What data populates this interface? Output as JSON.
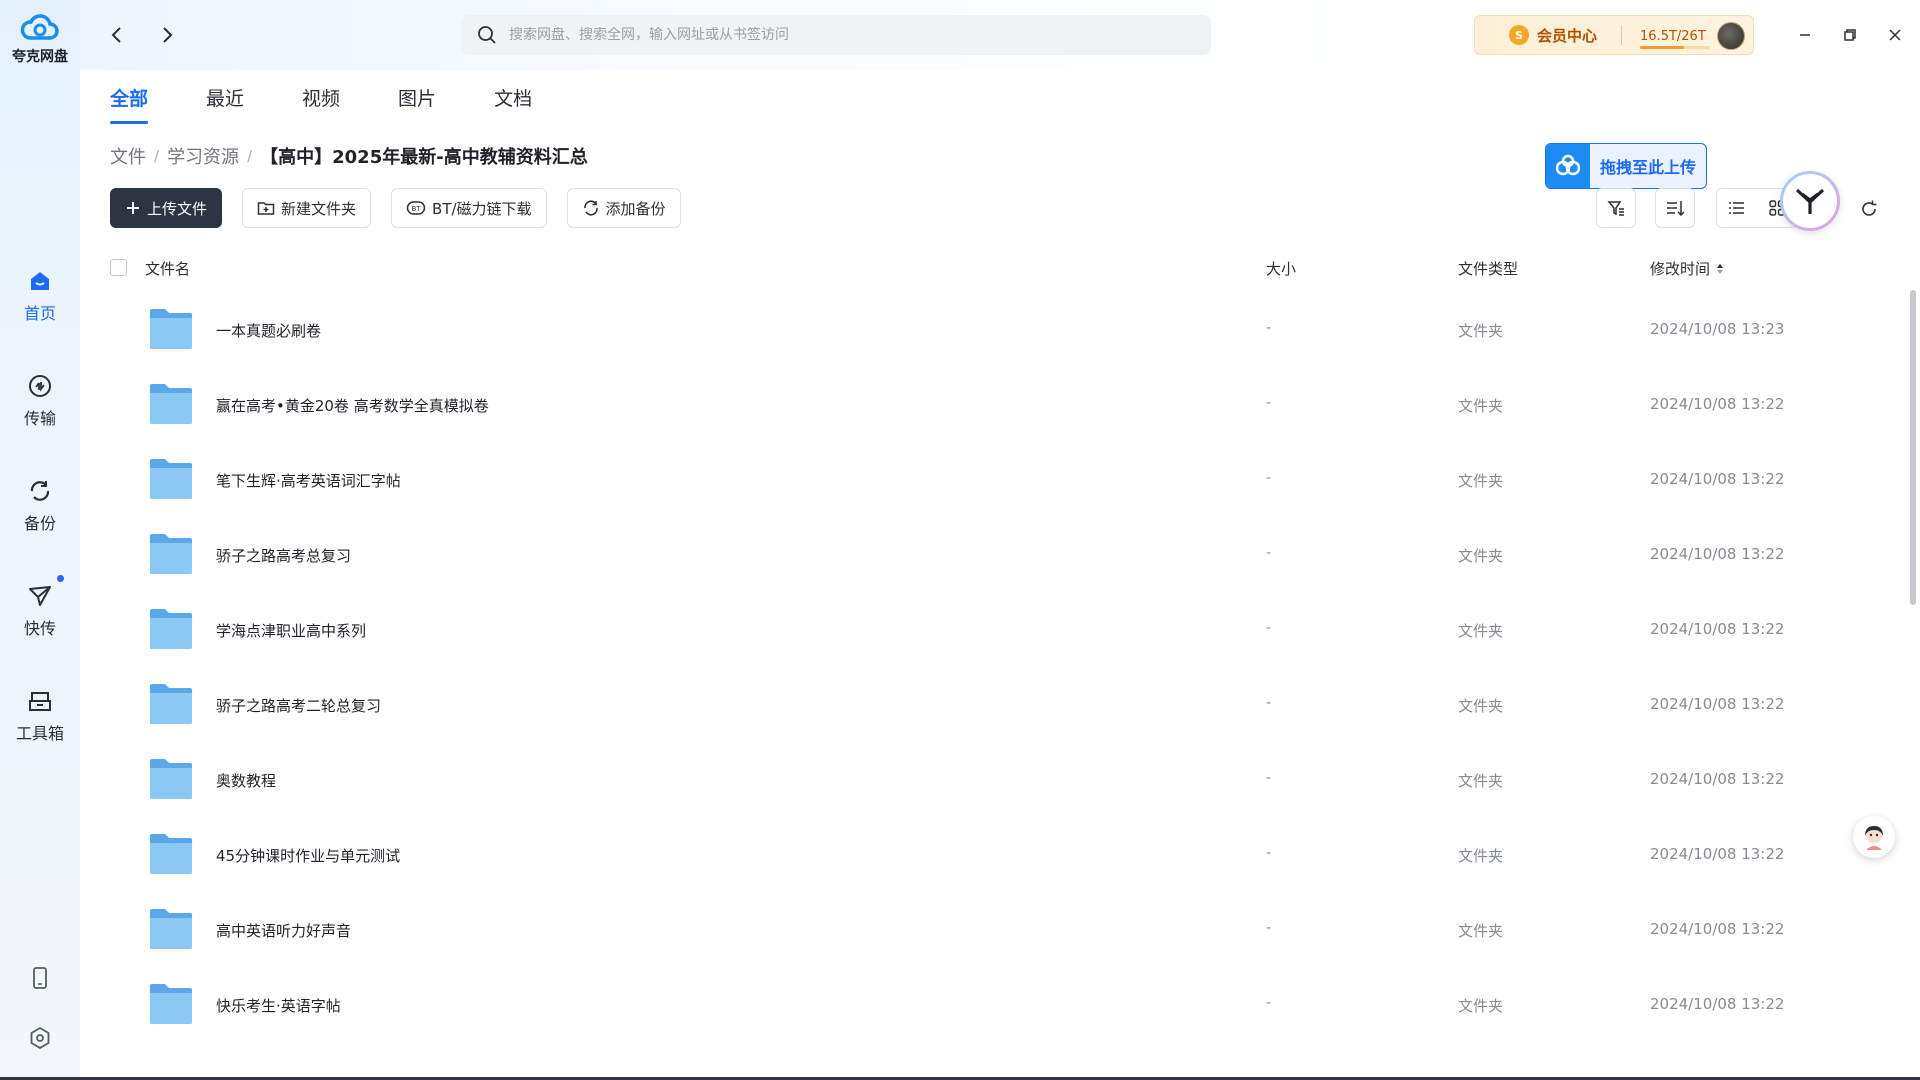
{
  "app": {
    "name": "夸克网盘"
  },
  "sidebar": {
    "items": [
      {
        "label": "首页",
        "icon": "home-icon",
        "active": true
      },
      {
        "label": "传输",
        "icon": "transfer-icon"
      },
      {
        "label": "备份",
        "icon": "backup-icon"
      },
      {
        "label": "快传",
        "icon": "quick-send-icon",
        "badge_dot": true
      },
      {
        "label": "工具箱",
        "icon": "toolbox-icon"
      }
    ],
    "bottom_icons": [
      "phone-icon",
      "settings-icon"
    ]
  },
  "header": {
    "search_placeholder": "搜索网盘、搜索全网，输入网址或从书签访问",
    "vip_label": "会员中心",
    "vip_badge": "S",
    "storage_text": "16.5T/26T",
    "storage_fraction": 0.63
  },
  "tabs": [
    {
      "label": "全部",
      "active": true
    },
    {
      "label": "最近"
    },
    {
      "label": "视频"
    },
    {
      "label": "图片"
    },
    {
      "label": "文档"
    }
  ],
  "breadcrumb": {
    "items": [
      "文件",
      "学习资源"
    ],
    "separator": "/",
    "current": "【高中】2025年最新-高中教辅资料汇总"
  },
  "upload_zone_label": "拖拽至此上传",
  "toolbar": {
    "upload": "上传文件",
    "new_folder": "新建文件夹",
    "bt_download": "BT/磁力链下载",
    "add_backup": "添加备份"
  },
  "table": {
    "headers": {
      "name": "文件名",
      "size": "大小",
      "type": "文件类型",
      "modified": "修改时间"
    },
    "rows": [
      {
        "name": "一本真题必刷卷",
        "size": "-",
        "type": "文件夹",
        "modified": "2024/10/08 13:23"
      },
      {
        "name": "赢在高考•黄金20卷 高考数学全真模拟卷",
        "size": "-",
        "type": "文件夹",
        "modified": "2024/10/08 13:22"
      },
      {
        "name": "笔下生辉·高考英语词汇字帖",
        "size": "-",
        "type": "文件夹",
        "modified": "2024/10/08 13:22"
      },
      {
        "name": "骄子之路高考总复习",
        "size": "-",
        "type": "文件夹",
        "modified": "2024/10/08 13:22"
      },
      {
        "name": "学海点津职业高中系列",
        "size": "-",
        "type": "文件夹",
        "modified": "2024/10/08 13:22"
      },
      {
        "name": "骄子之路高考二轮总复习",
        "size": "-",
        "type": "文件夹",
        "modified": "2024/10/08 13:22"
      },
      {
        "name": "奥数教程",
        "size": "-",
        "type": "文件夹",
        "modified": "2024/10/08 13:22"
      },
      {
        "name": "45分钟课时作业与单元测试",
        "size": "-",
        "type": "文件夹",
        "modified": "2024/10/08 13:22"
      },
      {
        "name": "高中英语听力好声音",
        "size": "-",
        "type": "文件夹",
        "modified": "2024/10/08 13:22"
      },
      {
        "name": "快乐考生·英语字帖",
        "size": "-",
        "type": "文件夹",
        "modified": "2024/10/08 13:22"
      }
    ]
  },
  "colors": {
    "accent": "#1c6bf2",
    "folder": "#7ec0f2",
    "vip_text": "#b34f00"
  }
}
